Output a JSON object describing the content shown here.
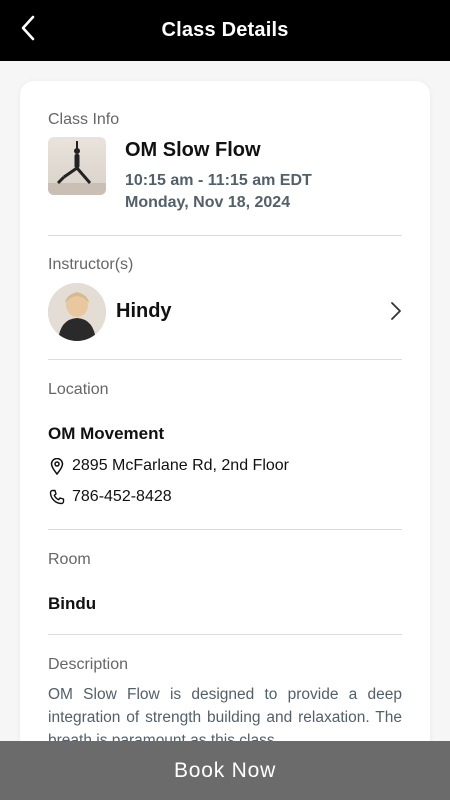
{
  "header": {
    "title": "Class Details",
    "back_icon": "chevron-left-icon"
  },
  "class_info": {
    "label": "Class Info",
    "name": "OM Slow Flow",
    "time": "10:15 am - 11:15 am EDT",
    "date": "Monday, Nov 18, 2024"
  },
  "instructor": {
    "label": "Instructor(s)",
    "name": "Hindy"
  },
  "location": {
    "label": "Location",
    "name": "OM Movement",
    "address": "2895 McFarlane Rd, 2nd Floor",
    "phone": "786-452-8428"
  },
  "room": {
    "label": "Room",
    "name": "Bindu"
  },
  "description": {
    "label": "Description",
    "text": "OM Slow Flow is designed to provide a deep integration of strength building and relaxation. The breath is paramount as this class"
  },
  "footer": {
    "book_label": "Book Now"
  },
  "colors": {
    "header_bg": "#000000",
    "button_bg": "#6b6b6b",
    "muted_text": "#52606b"
  }
}
